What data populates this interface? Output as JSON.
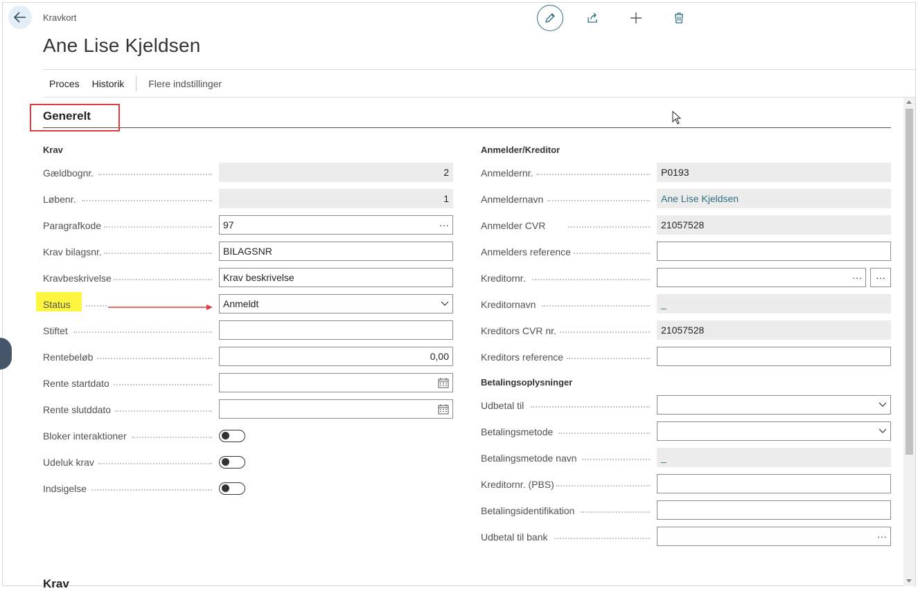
{
  "header": {
    "breadcrumb": "Kravkort",
    "title": "Ane Lise Kjeldsen"
  },
  "actions": {
    "items": [
      "Proces",
      "Historik"
    ],
    "more": "Flere indstillinger"
  },
  "section": {
    "title": "Generelt",
    "bottom_title": "Krav"
  },
  "left": {
    "group_title": "Krav",
    "fields": [
      {
        "label": "Gældbognr.",
        "value": "2"
      },
      {
        "label": "Løbenr.",
        "value": "1"
      },
      {
        "label": "Paragrafkode",
        "value": "97"
      },
      {
        "label": "Krav bilagsnr.",
        "value": "BILAGSNR"
      },
      {
        "label": "Kravbeskrivelse",
        "value": "Krav beskrivelse"
      },
      {
        "label": "Status",
        "value": "Anmeldt"
      },
      {
        "label": "Stiftet",
        "value": ""
      },
      {
        "label": "Rentebeløb",
        "value": "0,00"
      },
      {
        "label": "Rente startdato",
        "value": ""
      },
      {
        "label": "Rente slutddato",
        "value": ""
      },
      {
        "label": "Bloker interaktioner",
        "value": "off"
      },
      {
        "label": "Udeluk krav",
        "value": "off"
      },
      {
        "label": "Indsigelse",
        "value": "off"
      }
    ]
  },
  "right": {
    "group_title": "Anmelder/Kreditor",
    "fields": [
      {
        "label": "Anmeldernr.",
        "value": "P0193"
      },
      {
        "label": "Anmeldernavn",
        "value": "Ane Lise Kjeldsen"
      },
      {
        "label": "Anmelder CVR",
        "value": "21057528"
      },
      {
        "label": "Anmelders reference",
        "value": ""
      },
      {
        "label": "Kreditornr.",
        "value": ""
      },
      {
        "label": "Kreditornavn",
        "value": "_"
      },
      {
        "label": "Kreditors CVR nr.",
        "value": "21057528"
      },
      {
        "label": "Kreditors reference",
        "value": ""
      }
    ],
    "group2_title": "Betalingsoplysninger",
    "fields2": [
      {
        "label": "Udbetal til",
        "value": ""
      },
      {
        "label": "Betalingsmetode",
        "value": ""
      },
      {
        "label": "Betalingsmetode navn",
        "value": "_"
      },
      {
        "label": "Kreditornr. (PBS)",
        "value": ""
      },
      {
        "label": "Betalingsidentifikation",
        "value": ""
      },
      {
        "label": "Udbetal til bank",
        "value": ""
      }
    ]
  },
  "colors": {
    "accent": "#2d6e7e",
    "highlight": "#fdf640",
    "annotation": "#e03c3c"
  }
}
